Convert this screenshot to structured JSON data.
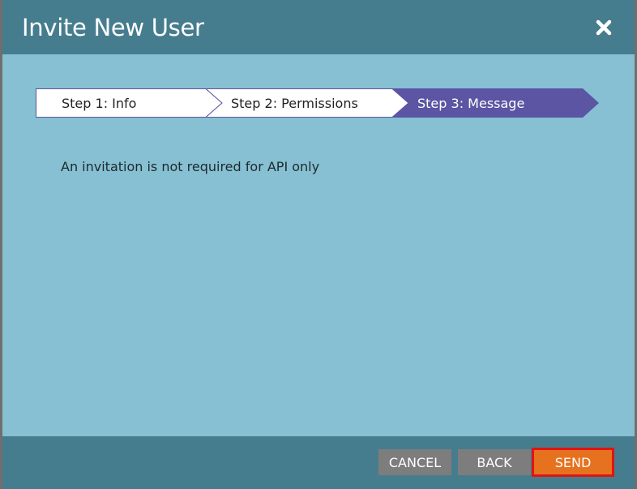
{
  "dialog": {
    "title": "Invite New User",
    "close_icon": "close-icon"
  },
  "wizard": {
    "steps": [
      {
        "label": "Step 1: Info",
        "active": false
      },
      {
        "label": "Step 2: Permissions",
        "active": false
      },
      {
        "label": "Step 3: Message",
        "active": true
      }
    ],
    "active_color": "#5b55a4"
  },
  "content": {
    "message": "An invitation is not required for API only"
  },
  "footer": {
    "cancel_label": "CANCEL",
    "back_label": "BACK",
    "send_label": "SEND"
  },
  "colors": {
    "header": "#467d8e",
    "body": "#86c0d2",
    "send_button": "#e6721f",
    "highlight": "#e01414"
  }
}
